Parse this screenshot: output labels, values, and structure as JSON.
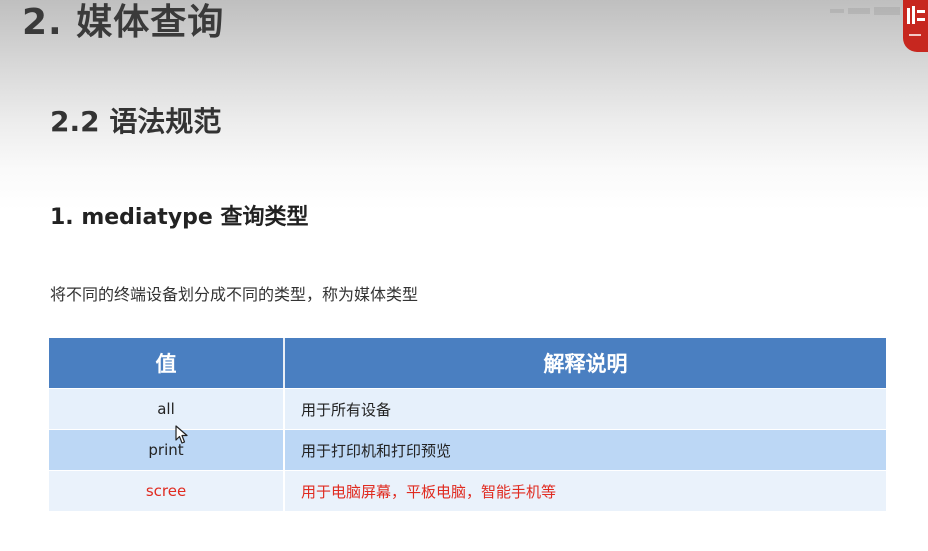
{
  "slide": {
    "title": "2. 媒体查询"
  },
  "section": {
    "title": "2.2 语法规范"
  },
  "subsection": {
    "title": "1. mediatype 查询类型"
  },
  "description": "将不同的终端设备划分成不同的类型，称为媒体类型",
  "table": {
    "headers": [
      "值",
      "解释说明"
    ],
    "rows": [
      {
        "value": "all",
        "desc": "用于所有设备"
      },
      {
        "value": "print",
        "desc": "用于打印机和打印预览"
      },
      {
        "value": "scree",
        "desc": "用于电脑屏幕，平板电脑，智能手机等"
      }
    ]
  },
  "colors": {
    "header_bg": "#4a7fc1",
    "row_light": "#e6f0fb",
    "row_dark": "#bcd7f5",
    "highlight_text": "#e02b20",
    "badge": "#c7271f"
  },
  "icons": {
    "cursor": "mouse-pointer-icon",
    "badge": "logo-badge-icon"
  }
}
